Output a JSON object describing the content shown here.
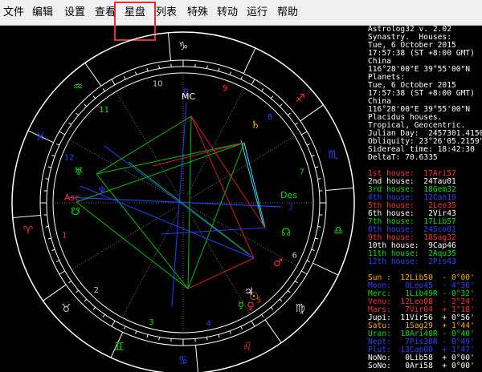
{
  "menu": {
    "items": [
      "文件",
      "编辑",
      "设置",
      "查看",
      "星盘",
      "列表",
      "特殊",
      "转动",
      "运行",
      "帮助"
    ],
    "highlighted": "星盘"
  },
  "chart": {
    "house_numbers": [
      "1",
      "2",
      "3",
      "4",
      "5",
      "6",
      "7",
      "8",
      "9",
      "10",
      "11",
      "12"
    ],
    "angle_labels": {
      "asc": "Asc",
      "des": "Des",
      "mc": "MC"
    },
    "colors": {
      "ring": "#ffffff",
      "aspect_green": "#00c000",
      "aspect_blue": "#2040ff",
      "aspect_red": "#d02020",
      "aspect_cyan": "#40e0ff",
      "house_line": "#8c8c8c"
    }
  },
  "panel": {
    "header": [
      "Astrolog32 v. 2.02",
      "Synastry.  Houses:",
      "Tue, 6 October 2015",
      "17:57:38 (ST +8:00 GMT)",
      "China",
      "116°28'00\"E 39°55'00\"N",
      "Planets:",
      "Tue, 6 October 2015",
      "17:57:38 (ST +8:00 GMT)",
      "China",
      "116°28'00\"E 39°55'00\"N",
      "Placidus houses.",
      "Tropical, Geocentric.",
      "Julian Day:  2457301.4150",
      "Obliquity: 23°26'05.2159\"",
      "Sidereal time: 18:42:30",
      "DeltaT: 70.6335"
    ],
    "houses": [
      {
        "text": "1st house:  17Ari57",
        "color": "#ff3030"
      },
      {
        "text": "2nd house:  24Tau01",
        "color": "#ffffff"
      },
      {
        "text": "3rd house:  18Gem32",
        "color": "#00e000"
      },
      {
        "text": "4th house:  12Can10",
        "color": "#3040ff"
      },
      {
        "text": "5th house:   2Leo35",
        "color": "#ff3030"
      },
      {
        "text": "6th house:   2Vir43",
        "color": "#ffffff"
      },
      {
        "text": "7th house:  17Lib57",
        "color": "#00e000"
      },
      {
        "text": "8th house:  24Sco01",
        "color": "#3040ff"
      },
      {
        "text": "9th house:  18Sag32",
        "color": "#ff3030"
      },
      {
        "text": "10th house:  9Cap46",
        "color": "#ffffff"
      },
      {
        "text": "11th house:  2Aqu35",
        "color": "#00e000"
      },
      {
        "text": "12th house:  2Pis43",
        "color": "#3040ff"
      }
    ],
    "planets": [
      {
        "text": "Sun :  12Lib50  - 0°00'",
        "color": "#ffb000"
      },
      {
        "text": "Moon:   0Leo45  - 4°36'",
        "color": "#3040ff"
      },
      {
        "text": "Merc:   1Lib49R - 0°32'",
        "color": "#00e000"
      },
      {
        "text": "Venu:  12Leo08  - 2°24'",
        "color": "#ff3030"
      },
      {
        "text": "Mars:   7Vir04  + 1°18'",
        "color": "#ff3030"
      },
      {
        "text": "Jupi:  11Vir56  + 0°56'",
        "color": "#ffffff"
      },
      {
        "text": "Satu:   1Sag29  + 1°44'",
        "color": "#ffb000"
      },
      {
        "text": "Uran:  18Ari48R - 0°40'",
        "color": "#00e000"
      },
      {
        "text": "Nept:   7Pis38R - 0°49'",
        "color": "#3040ff"
      },
      {
        "text": "Plut:  13Cap00  + 1°47'",
        "color": "#3040ff"
      },
      {
        "text": "NoNo:   0Lib58  + 0°00'",
        "color": "#ffffff"
      },
      {
        "text": "SoNo:   0Ari58  + 0°00'",
        "color": "#ffffff"
      }
    ]
  }
}
